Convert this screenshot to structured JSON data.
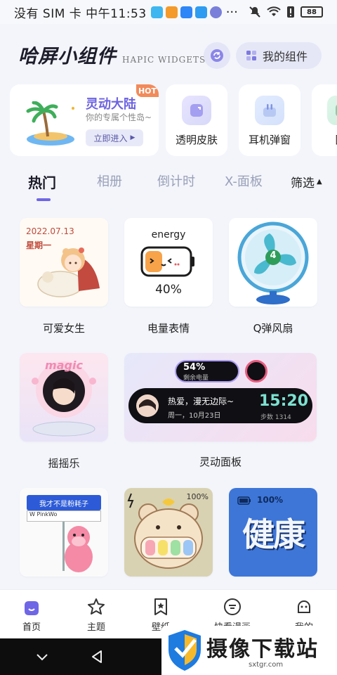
{
  "status_bar": {
    "carrier": "没有 SIM 卡 中午11:53",
    "more": "···",
    "battery": "88"
  },
  "header": {
    "brand_cn": "哈屏小组件",
    "brand_en": "HAPIC WIDGETS",
    "my_widgets": "我的组件"
  },
  "promo": {
    "badge": "HOT",
    "title": "灵动大陆",
    "subtitle": "你的专属个性岛~",
    "enter_label": "立即进入"
  },
  "feature_cards": [
    {
      "label": "透明皮肤",
      "icon": "transparent-skin-icon"
    },
    {
      "label": "耳机弹窗",
      "icon": "earphone-icon"
    },
    {
      "label": "图",
      "icon": "picture-icon"
    }
  ],
  "tabs": {
    "items": [
      "热门",
      "相册",
      "倒计时",
      "X-面板"
    ],
    "active": "热门",
    "filter": "筛选"
  },
  "widgets": {
    "cute_girl": {
      "label": "可爱女生",
      "date": "2022.07.13",
      "weekday": "星期一"
    },
    "battery_face": {
      "label": "电量表情",
      "heading": "energy",
      "percent": "40%"
    },
    "fan": {
      "label": "Q弹风扇",
      "speed": "4"
    },
    "swing": {
      "label": "摇摇乐",
      "banner": "magic"
    },
    "dynamic_panel": {
      "label": "灵动面板",
      "battery_percent": "54%",
      "battery_caption": "剩余电量",
      "song": "热爱，漫无边际~",
      "date_line": "周一，10月23日",
      "time": "15:20",
      "steps": "步数 1314"
    },
    "sign": {
      "sign_text": "我才不是粉耗子",
      "small_text": "W PinkWo"
    },
    "bear": {
      "percent": "100%"
    },
    "health": {
      "percent": "100%",
      "text": "健康"
    }
  },
  "bottom_nav": [
    {
      "label": "首页",
      "icon": "home-icon"
    },
    {
      "label": "主题",
      "icon": "star-icon"
    },
    {
      "label": "壁纸",
      "icon": "bookmark-icon"
    },
    {
      "label": "快看漫画",
      "icon": "comic-icon"
    },
    {
      "label": "我的",
      "icon": "profile-icon"
    }
  ],
  "watermark": {
    "text": "摄像下载站",
    "url": "sxtgr.com"
  },
  "colors": {
    "accent": "#6f66e6",
    "background": "#f3f5fb"
  }
}
